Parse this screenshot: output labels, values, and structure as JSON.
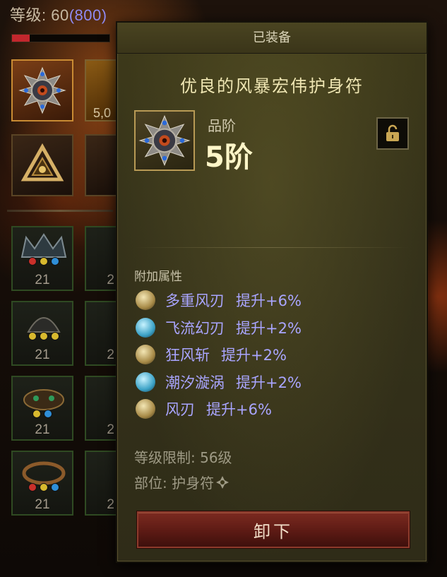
{
  "status": {
    "level_label": "等级:",
    "level_value": "60",
    "paragon": "(800)",
    "xp_fill_fraction": 0.18
  },
  "left_slots": {
    "partial_count": "5,0"
  },
  "inventory": {
    "counts": [
      "21",
      "21",
      "21",
      "21"
    ],
    "partial_counts": [
      "2",
      "2",
      "2",
      "2"
    ]
  },
  "tooltip": {
    "header": "已装备",
    "item_name": "优良的风暴宏伟护身符",
    "grade_label": "品阶",
    "grade_value": "5阶",
    "attr_title": "附加属性",
    "attributes": [
      {
        "name": "多重风刃",
        "bonus": "提升+6%",
        "icon": "wind-blade-icon"
      },
      {
        "name": "飞流幻刃",
        "bonus": "提升+2%",
        "icon": "water-blade-icon"
      },
      {
        "name": "狂风斩",
        "bonus": "提升+2%",
        "icon": "gale-slash-icon"
      },
      {
        "name": "潮汐漩涡",
        "bonus": "提升+2%",
        "icon": "tide-vortex-icon"
      },
      {
        "name": "风刃",
        "bonus": "提升+6%",
        "icon": "wind-blade-icon"
      }
    ],
    "level_req": "等级限制: 56级",
    "slot_label": "部位: 护身符",
    "unequip_button": "卸下"
  },
  "colors": {
    "attribute_text": "#a9a5ff",
    "item_name": "#efe6b3",
    "button_bg": "#6b2219",
    "panel_bg": "#3a3619"
  }
}
